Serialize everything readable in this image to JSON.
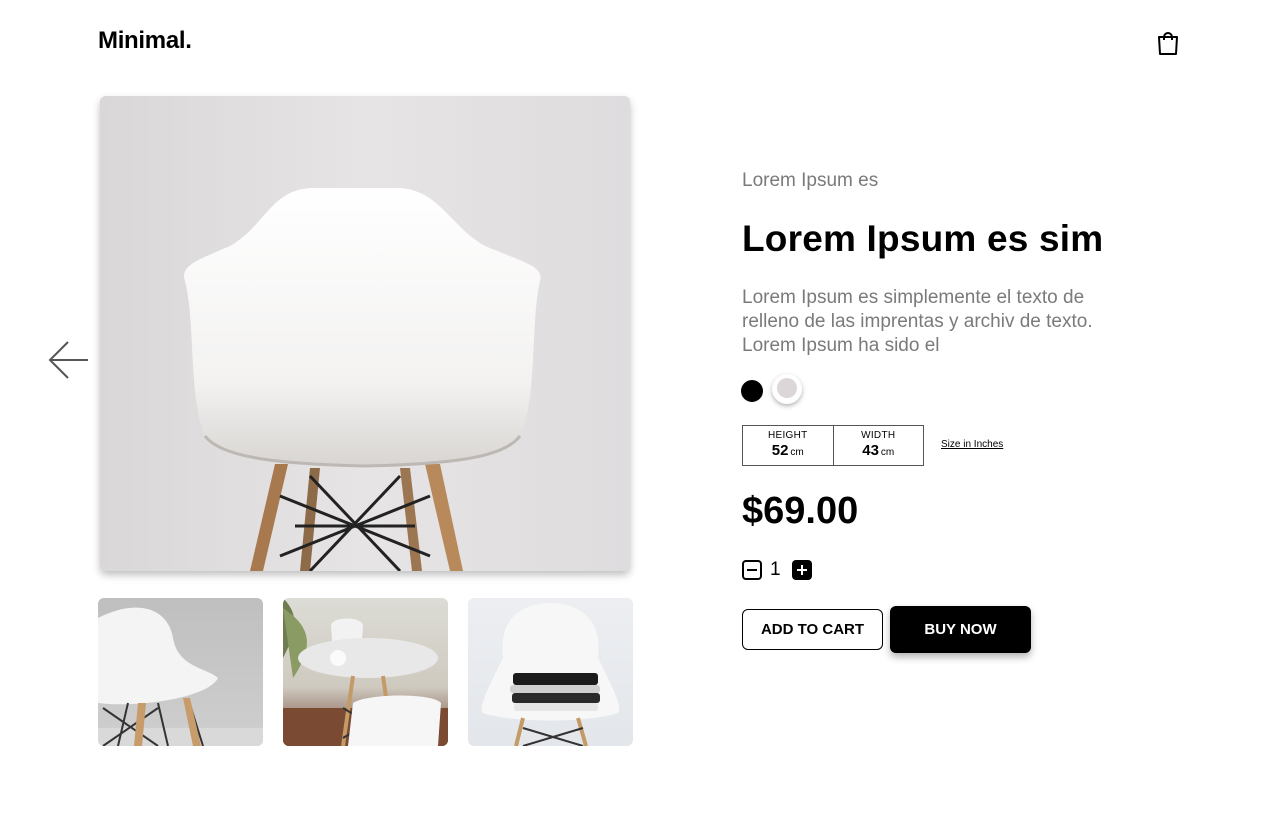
{
  "header": {
    "logo": "Minimal.",
    "cart_icon": "shopping-bag-icon"
  },
  "gallery": {
    "prev_icon": "arrow-left-icon",
    "main_image": "white-chair-photo",
    "thumbnails": [
      "chair-side-photo",
      "table-chairs-photo",
      "chair-clothes-photo"
    ]
  },
  "product": {
    "subtitle": "Lorem Ipsum es",
    "title": "Lorem Ipsum es sim",
    "description": "Lorem Ipsum es simplemente el texto de relleno de las imprentas y archiv de texto. Lorem Ipsum ha sido el",
    "colors": [
      {
        "name": "black",
        "hex": "#000000"
      },
      {
        "name": "light-gray",
        "hex": "#dcd6d8",
        "selected": true
      }
    ],
    "dimensions": {
      "height": {
        "label": "HEIGHT",
        "value": "52",
        "unit": "cm"
      },
      "width": {
        "label": "WIDTH",
        "value": "43",
        "unit": "cm"
      },
      "size_link": "Size in Inches"
    },
    "price": "$69.00",
    "quantity": "1",
    "add_to_cart": "ADD TO CART",
    "buy_now": "BUY NOW"
  }
}
